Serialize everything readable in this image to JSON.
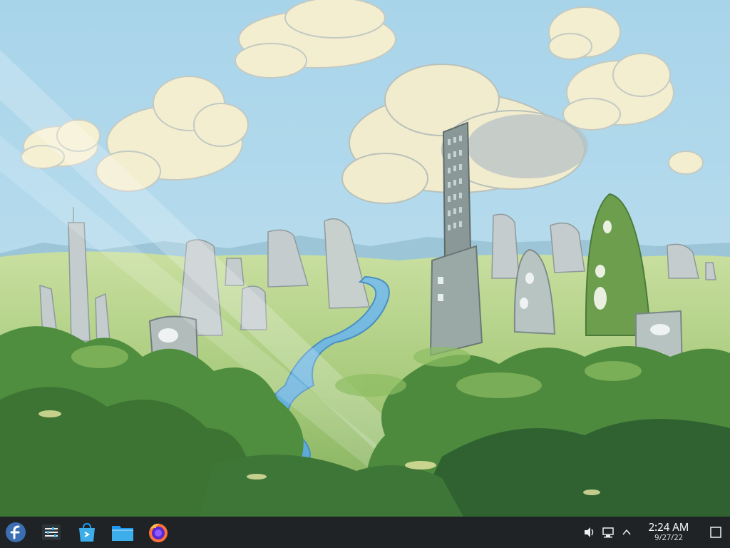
{
  "desktop": {
    "wallpaper_name": "illustrated-green-city-wallpaper"
  },
  "taskbar": {
    "pinned": [
      {
        "name": "fedora-launcher",
        "icon": "fedora-logo-icon"
      },
      {
        "name": "system-settings",
        "icon": "settings-sliders-icon"
      },
      {
        "name": "discover",
        "icon": "store-bag-icon"
      },
      {
        "name": "dolphin-files",
        "icon": "folder-icon"
      },
      {
        "name": "firefox",
        "icon": "firefox-icon"
      }
    ],
    "tray": {
      "icons": [
        "volume-icon",
        "network-icon",
        "chevron-up-icon"
      ],
      "clock": {
        "time": "2:24 AM",
        "date": "9/27/22"
      }
    }
  },
  "colors": {
    "taskbar_bg": "#1f2325",
    "sky": "#a9d6ea",
    "accent": "#3daee9"
  }
}
